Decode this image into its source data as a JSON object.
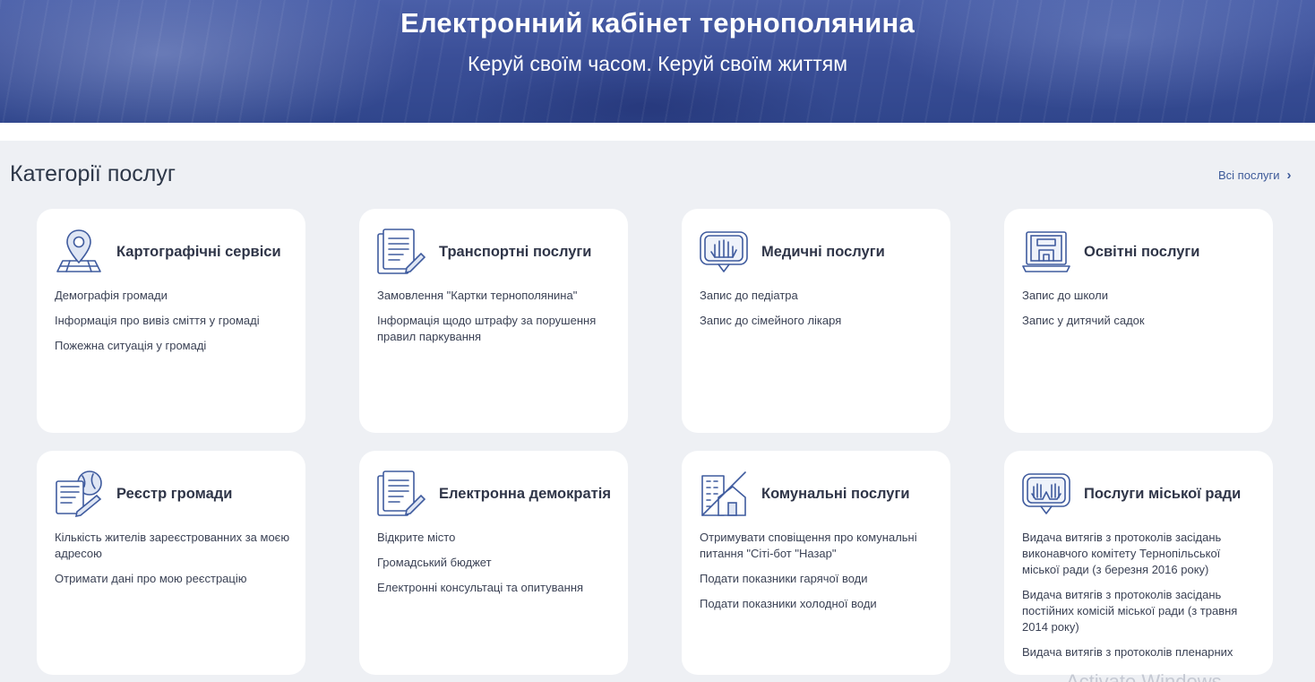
{
  "header": {
    "title": "Електронний кабінет тернополянина",
    "subtitle": "Керуй своїм часом. Керуй своїм життям"
  },
  "section": {
    "title": "Категорії послуг",
    "all_link": "Всі послуги"
  },
  "cards": [
    {
      "title": "Картографічні сервіси",
      "icon": "map-pin-icon",
      "links": [
        "Демографія громади",
        "Інформація про вивіз сміття у громаді",
        "Пожежна ситуація у громаді"
      ]
    },
    {
      "title": "Транспортні послуги",
      "icon": "document-pen-icon",
      "links": [
        "Замовлення \"Картки тернополянина\"",
        "Інформація щодо штрафу за порушення правил паркування"
      ]
    },
    {
      "title": "Медичні послуги",
      "icon": "medical-hand-icon",
      "links": [
        "Запис до педіатра",
        "Запис до сімейного лікаря"
      ]
    },
    {
      "title": "Освітні послуги",
      "icon": "laptop-school-icon",
      "links": [
        "Запис до школи",
        "Запис у дитячий садок"
      ]
    },
    {
      "title": "Реєстр громади",
      "icon": "registry-globe-icon",
      "links": [
        "Кількість жителів зареєстрованних за моєю адресою",
        "Отримати дані про мою реєстрацію"
      ]
    },
    {
      "title": "Електронна демократія",
      "icon": "document-pen-icon",
      "links": [
        "Відкрите місто",
        "Громадський бюджет",
        "Електронні консультаці та опитування"
      ]
    },
    {
      "title": "Комунальні послуги",
      "icon": "house-building-icon",
      "links": [
        "Отримувати сповіщення про комунальні питання \"Сіті-бот \"Назар\"",
        "Подати показники гарячої води",
        "Подати показники холодної води"
      ]
    },
    {
      "title": "Послуги міської ради",
      "icon": "council-hands-icon",
      "links": [
        "Видача витягів з протоколів засідань виконавчого комітету Тернопільської міської ради (з березня 2016 року)",
        "Видача витягів з протоколів засідань постійних комісій міської ради (з травня 2014 року)",
        "Видача витягів з протоколів пленарних"
      ]
    }
  ],
  "watermark": "Activate Windows"
}
